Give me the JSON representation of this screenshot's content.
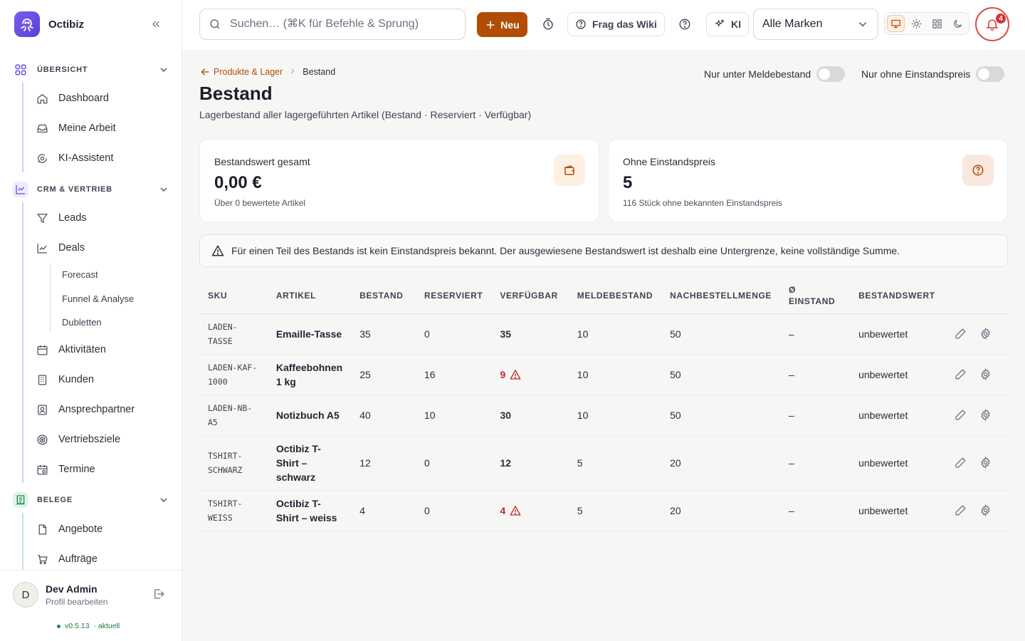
{
  "app": {
    "name": "Octibiz"
  },
  "sidebar": {
    "sections": [
      {
        "title": "ÜBERSICHT",
        "items": [
          {
            "label": "Dashboard",
            "icon": "home-icon"
          },
          {
            "label": "Meine Arbeit",
            "icon": "inbox-icon"
          },
          {
            "label": "KI-Assistent",
            "icon": "chat-search-icon"
          }
        ]
      },
      {
        "title": "CRM & VERTRIEB",
        "items": [
          {
            "label": "Leads",
            "icon": "filter-icon"
          },
          {
            "label": "Deals",
            "icon": "chart-line-icon"
          },
          {
            "label": "Aktivitäten",
            "icon": "calendar-icon"
          },
          {
            "label": "Kunden",
            "icon": "building-icon"
          },
          {
            "label": "Ansprechpartner",
            "icon": "contact-icon"
          },
          {
            "label": "Vertriebsziele",
            "icon": "target-icon"
          },
          {
            "label": "Termine",
            "icon": "calendar-clock-icon"
          }
        ],
        "subitems": [
          "Forecast",
          "Funnel & Analyse",
          "Dubletten"
        ]
      },
      {
        "title": "BELEGE",
        "items": [
          {
            "label": "Angebote",
            "icon": "file-icon"
          },
          {
            "label": "Aufträge",
            "icon": "cart-icon"
          }
        ]
      }
    ],
    "user": {
      "initial": "D",
      "name": "Dev Admin",
      "sub": "Profil bearbeiten"
    },
    "version": {
      "number": "v0.5.13",
      "status": "· aktuell"
    }
  },
  "topbar": {
    "search_placeholder": "Suchen… (⌘K für Befehle & Sprung)",
    "new_label": "Neu",
    "wiki_label": "Frag das Wiki",
    "ai_label": "KI",
    "brand_select": "Alle Marken",
    "notification_count": "4"
  },
  "page": {
    "breadcrumb_parent": "Produkte & Lager",
    "breadcrumb_current": "Bestand",
    "title": "Bestand",
    "subtitle": "Lagerbestand aller lagergeführten Artikel (Bestand · Reserviert · Verfügbar)",
    "toggle_meldebestand": "Nur unter Meldebestand",
    "toggle_einstandspreis": "Nur ohne Einstandspreis",
    "toggle_meldebestand_on": false,
    "toggle_einstandspreis_on": false
  },
  "cards": [
    {
      "label": "Bestandswert gesamt",
      "value": "0,00 €",
      "note": "Über 0 bewertete Artikel",
      "icon": "wallet-icon"
    },
    {
      "label": "Ohne Einstandspreis",
      "value": "5",
      "note": "116 Stück ohne bekannten Einstandspreis",
      "icon": "question-circle-icon"
    }
  ],
  "alert": "Für einen Teil des Bestands ist kein Einstandspreis bekannt. Der ausgewiesene Bestandswert ist deshalb eine Untergrenze, keine vollständige Summe.",
  "table": {
    "headers": [
      "SKU",
      "ARTIKEL",
      "BESTAND",
      "RESERVIERT",
      "VERFÜGBAR",
      "MELDEBESTAND",
      "NACHBESTELLMENGE",
      "Ø EINSTAND",
      "BESTANDSWERT"
    ],
    "rows": [
      {
        "sku": "LADEN-TASSE",
        "sku_l1": "LADEN-",
        "sku_l2": "TASSE",
        "art_l1": "Emaille-Tasse",
        "art_l2": "",
        "art_l3": "",
        "bestand": "35",
        "reserviert": "0",
        "verfuegbar": "35",
        "warn": false,
        "meldebestand": "10",
        "nachbestell": "50",
        "einstand": "–",
        "wert": "unbewertet"
      },
      {
        "sku": "LADEN-KAF-1000",
        "sku_l1": "LADEN-KAF-",
        "sku_l2": "1000",
        "art_l1": "Kaffeebohnen",
        "art_l2": "1 kg",
        "art_l3": "",
        "bestand": "25",
        "reserviert": "16",
        "verfuegbar": "9",
        "warn": true,
        "meldebestand": "10",
        "nachbestell": "50",
        "einstand": "–",
        "wert": "unbewertet"
      },
      {
        "sku": "LADEN-NB-A5",
        "sku_l1": "LADEN-NB-",
        "sku_l2": "A5",
        "art_l1": "Notizbuch A5",
        "art_l2": "",
        "art_l3": "",
        "bestand": "40",
        "reserviert": "10",
        "verfuegbar": "30",
        "warn": false,
        "meldebestand": "10",
        "nachbestell": "50",
        "einstand": "–",
        "wert": "unbewertet"
      },
      {
        "sku": "TSHIRT-SCHWARZ",
        "sku_l1": "TSHIRT-",
        "sku_l2": "SCHWARZ",
        "art_l1": "Octibiz T-",
        "art_l2": "Shirt –",
        "art_l3": "schwarz",
        "bestand": "12",
        "reserviert": "0",
        "verfuegbar": "12",
        "warn": false,
        "meldebestand": "5",
        "nachbestell": "20",
        "einstand": "–",
        "wert": "unbewertet"
      },
      {
        "sku": "TSHIRT-WEISS",
        "sku_l1": "TSHIRT-",
        "sku_l2": "WEISS",
        "art_l1": "Octibiz T-",
        "art_l2": "Shirt – weiss",
        "art_l3": "",
        "bestand": "4",
        "reserviert": "0",
        "verfuegbar": "4",
        "warn": true,
        "meldebestand": "5",
        "nachbestell": "20",
        "einstand": "–",
        "wert": "unbewertet"
      }
    ]
  },
  "colors": {
    "accent": "#b24d05",
    "warn": "#c0262d",
    "brand_logo": "#6d4ee6"
  }
}
